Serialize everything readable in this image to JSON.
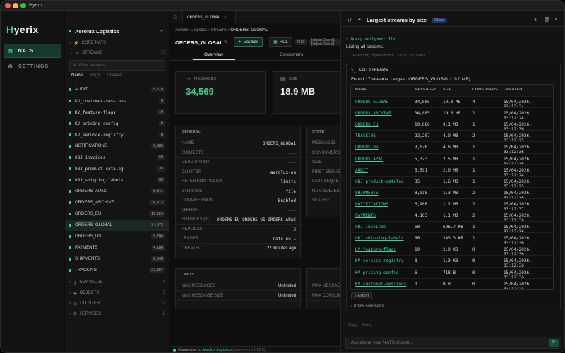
{
  "window": {
    "title": "Hyerix"
  },
  "rail": {
    "logo_prefix": "H",
    "logo_rest": "yerix",
    "items": [
      {
        "label": "NATS",
        "icon": "N"
      },
      {
        "label": "SETTINGS",
        "icon": "⚙"
      }
    ]
  },
  "nav": {
    "context_name": "Aerolux Logistics",
    "core_nats": "CORE NATS",
    "streams_header": "STREAMS",
    "streams_count": "17",
    "filter_placeholder": "Filter streams...",
    "sort_tabs": [
      "Name",
      "Msgs",
      "Created"
    ],
    "streams": [
      {
        "name": "AUDIT",
        "count": "5,518",
        "mono": false
      },
      {
        "name": "KV_customer-sessions",
        "count": "6",
        "mono": true
      },
      {
        "name": "KV_feature-flags",
        "count": "19",
        "mono": true
      },
      {
        "name": "KV_pricing-config",
        "count": "6",
        "mono": true
      },
      {
        "name": "KV_service-registry",
        "count": "8",
        "mono": true
      },
      {
        "name": "NOTIFICATIONS",
        "count": "6,985",
        "mono": false
      },
      {
        "name": "OBJ_invoices",
        "count": "60",
        "mono": true
      },
      {
        "name": "OBJ_product-catalog",
        "count": "35",
        "mono": true
      },
      {
        "name": "OBJ_shipping-labels",
        "count": "60",
        "mono": true
      },
      {
        "name": "ORDERS_APAC",
        "count": "5,341",
        "mono": false
      },
      {
        "name": "ORDERS_ARCHIVE",
        "count": "34,973",
        "mono": false
      },
      {
        "name": "ORDERS_EU",
        "count": "19,924",
        "mono": false
      },
      {
        "name": "ORDERS_GLOBAL",
        "count": "34,973",
        "mono": false
      },
      {
        "name": "ORDERS_US",
        "count": "9,706",
        "mono": false
      },
      {
        "name": "PAYMENTS",
        "count": "4,180",
        "mono": false
      },
      {
        "name": "SHIPMENTS",
        "count": "8,048",
        "mono": false
      },
      {
        "name": "TRACKING",
        "count": "22,387",
        "mono": false
      }
    ],
    "sections": [
      {
        "label": "KEY-VALUE",
        "count": "4"
      },
      {
        "label": "OBJECTS",
        "count": "3"
      },
      {
        "label": "CLUSTER",
        "count": "12"
      },
      {
        "label": "SERVICES",
        "count": "8"
      }
    ]
  },
  "main": {
    "tab": "ORDERS_GLOBAL",
    "breadcrumb": [
      "Aerolux Logistics",
      "Streams",
      "ORDERS_GLOBAL"
    ],
    "title": "ORDERS_GLOBAL",
    "validate": "Validate",
    "hcl": "HCL",
    "file": "FILE",
    "limits": [
      {
        "k": "MAX MESSAGES",
        "v": "Unlimited"
      },
      {
        "k": "MAX MESSAGE SIZE",
        "v": "Unlimited"
      }
    ],
    "subtabs": [
      "Overview",
      "Consumers"
    ],
    "messages_label": "MESSAGES",
    "messages_value": "34,569",
    "size_label": "SIZE",
    "size_value": "18.9 MB",
    "general_title": "GENERAL",
    "general": [
      {
        "k": "NAME",
        "v": "ORDERS_GLOBAL"
      },
      {
        "k": "SUBJECTS",
        "v": "---"
      },
      {
        "k": "DESCRIPTION",
        "v": "---"
      },
      {
        "k": "CLUSTER",
        "v": "aerolux-eu"
      },
      {
        "k": "RETENTION POLICY",
        "v": "limits"
      },
      {
        "k": "STORAGE",
        "v": "file"
      },
      {
        "k": "COMPRESSION",
        "v": "Enabled"
      },
      {
        "k": "MIRROR",
        "v": "---"
      },
      {
        "k": "SOURCES (3)",
        "v": "ORDERS_EU  ORDERS_US  ORDERS_APAC"
      },
      {
        "k": "REPLICAS",
        "v": "3"
      },
      {
        "k": "LEADER",
        "v": "nats-eu-1"
      },
      {
        "k": "CREATED",
        "v": "22 minutes ago"
      }
    ],
    "state_title": "STATE",
    "state_keys": [
      "MESSAGES",
      "CONSUMERS",
      "SIZE",
      "FIRST SEQUE",
      "LAST SEQUE",
      "NUM SUBJEC",
      "SEALED"
    ],
    "limits_title": "LIMITS",
    "limits_right": [
      "MAX MESSAG",
      "MAX CONSUM"
    ],
    "status_prefix": "Connected to",
    "status_ctx": "Aerolux Logistics",
    "status_suffix": "(nats-eu-1 v2.12.0)"
  },
  "chat": {
    "title": "Largest streams by size",
    "cloud": "Cloud",
    "query": "Query analyzed: 1lm",
    "listing": "Listing all streams.",
    "op": "1. Running operation: list_streams",
    "panel_title": "LIST STREAMS",
    "found": "Found 17 streams. Largest: ORDERS_GLOBAL (19.0 MB)",
    "columns": [
      "NAME",
      "MESSAGES",
      "SIZE",
      "CONSUMERS",
      "CREATED"
    ],
    "rows": [
      [
        "ORDERS_GLOBAL",
        "34,885",
        "19.0 MB",
        "4",
        "15/04/2026, 03:12:24"
      ],
      [
        "ORDERS_ARCHIVE",
        "34,885",
        "19.0 MB",
        "1",
        "15/04/2026, 03:12:24"
      ],
      [
        "ORDERS_EU",
        "19,886",
        "9.1 MB",
        "1",
        "15/04/2026, 03:12:36"
      ],
      [
        "TRACKING",
        "22,287",
        "4.9 MB",
        "2",
        "15/04/2026, 03:12:25"
      ],
      [
        "ORDERS_US",
        "9,676",
        "4.6 MB",
        "1",
        "15/04/2026, 03:12:36"
      ],
      [
        "ORDERS_APAC",
        "5,323",
        "2.5 MB",
        "1",
        "15/04/2026, 03:12:36"
      ],
      [
        "AUDIT",
        "5,591",
        "2.0 MB",
        "1",
        "15/04/2026, 03:12:24"
      ],
      [
        "OBJ_product-catalog",
        "35",
        "1.6 MB",
        "1",
        "15/04/2026, 03:12:25"
      ],
      [
        "SHIPMENTS",
        "8,018",
        "1.3 MB",
        "2",
        "15/04/2026, 03:12:36"
      ],
      [
        "NOTIFICATIONS",
        "6,966",
        "1.2 MB",
        "2",
        "15/04/2026, 03:12:37"
      ],
      [
        "PAYMENTS",
        "4,163",
        "1.1 MB",
        "2",
        "15/04/2026, 03:12:36"
      ],
      [
        "OBJ_invoices",
        "50",
        "696.7 KB",
        "1",
        "15/04/2026, 03:12:36"
      ],
      [
        "OBJ_shipping-labels",
        "60",
        "343.3 KB",
        "1",
        "15/04/2026, 03:12:36"
      ],
      [
        "KV_feature-flags",
        "19",
        "2.0 KB",
        "0",
        "15/04/2026, 03:12:36"
      ],
      [
        "KV_service-registry",
        "8",
        "1.3 KB",
        "0",
        "15/04/2026, 03:12:36"
      ],
      [
        "KV_pricing-config",
        "6",
        "718 B",
        "0",
        "15/04/2026, 03:12:36"
      ],
      [
        "KV_customer-sessions",
        "0",
        "0 B",
        "0",
        "15/04/2026, 03:12:24"
      ]
    ],
    "export": "Export",
    "show_command": "Show command",
    "copy": "Copy",
    "retry": "Retry",
    "input_placeholder": "Ask about your NATS cluster..."
  },
  "colors": {
    "accent": "#34d399",
    "bg": "#0c0c0c"
  }
}
